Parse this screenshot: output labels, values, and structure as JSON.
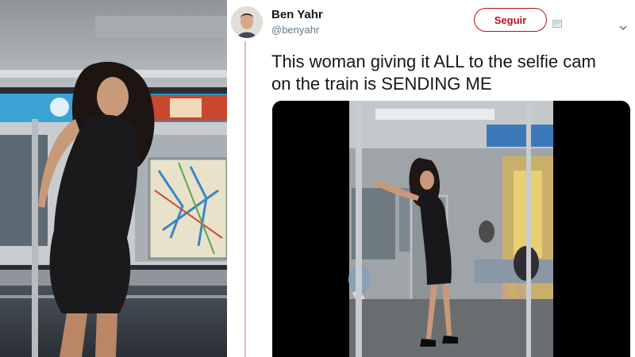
{
  "tweet": {
    "author_name": "Ben Yahr",
    "author_handle": "@benyahr",
    "follow_label": "Seguir",
    "text": "This woman giving it ALL to the selfie cam on the train is SENDING ME"
  },
  "icons": {
    "notify": "notification-icon",
    "caret": "chevron-down-icon"
  },
  "colors": {
    "follow_accent": "#b3121e",
    "thread_line": "#e8b7bd",
    "handle_text": "#657786",
    "primary_text": "#14171a"
  }
}
